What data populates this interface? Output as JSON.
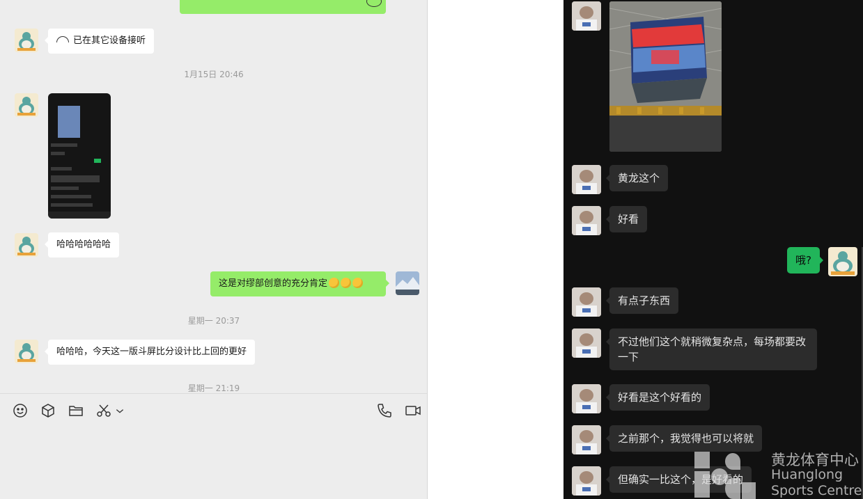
{
  "left_chat": {
    "messages": [
      {
        "id": "m1",
        "side": "left",
        "type": "call",
        "text": "已在其它设备接听"
      },
      {
        "id": "t1",
        "type": "timestamp",
        "text": "1月15日 20:46"
      },
      {
        "id": "m2",
        "side": "left",
        "type": "screenshot-thumbnail"
      },
      {
        "id": "m3",
        "side": "left",
        "type": "text",
        "text": "哈哈哈哈哈哈"
      },
      {
        "id": "m4",
        "side": "right",
        "type": "text",
        "text": "这是对缪部创意的充分肯定"
      },
      {
        "id": "t2",
        "type": "timestamp",
        "text": "星期一 20:37"
      },
      {
        "id": "m5",
        "side": "left",
        "type": "text",
        "text": "哈哈哈，今天这一版斗屏比分设计比上回的更好"
      },
      {
        "id": "t3",
        "type": "timestamp",
        "text": "星期一 21:19"
      }
    ],
    "toolbar": {
      "left_tools": [
        "emoji-icon",
        "cube-icon",
        "folder-icon",
        "scissors-icon",
        "chevron-down-icon"
      ],
      "right_tools": [
        "phone-icon",
        "video-camera-icon"
      ]
    },
    "colors": {
      "background": "#ededed",
      "bubble_sent": "#95ec69",
      "bubble_received": "#ffffff"
    }
  },
  "right_chat": {
    "messages": [
      {
        "id": "r1",
        "side": "left",
        "type": "photo-arena-scoreboard"
      },
      {
        "id": "r2",
        "side": "left",
        "text": "黄龙这个"
      },
      {
        "id": "r3",
        "side": "left",
        "text": "好看"
      },
      {
        "id": "r4",
        "side": "right",
        "text": "哦?"
      },
      {
        "id": "r5",
        "side": "left",
        "text": "有点子东西"
      },
      {
        "id": "r6",
        "side": "left",
        "text": "不过他们这个就稍微复杂点，每场都要改一下"
      },
      {
        "id": "r7",
        "side": "left",
        "text": "好看是这个好看的"
      },
      {
        "id": "r8",
        "side": "left",
        "text": "之前那个，我觉得也可以将就"
      },
      {
        "id": "r9",
        "side": "left",
        "text": "但确实一比这个，是好看的"
      }
    ],
    "colors": {
      "background": "#111111",
      "bubble_received": "#2c2c2c",
      "bubble_sent": "#21b55a"
    }
  },
  "watermark": {
    "cn": "黄龙体育中心",
    "en_line1": "Huanglong",
    "en_line2": "Sports Centre"
  }
}
